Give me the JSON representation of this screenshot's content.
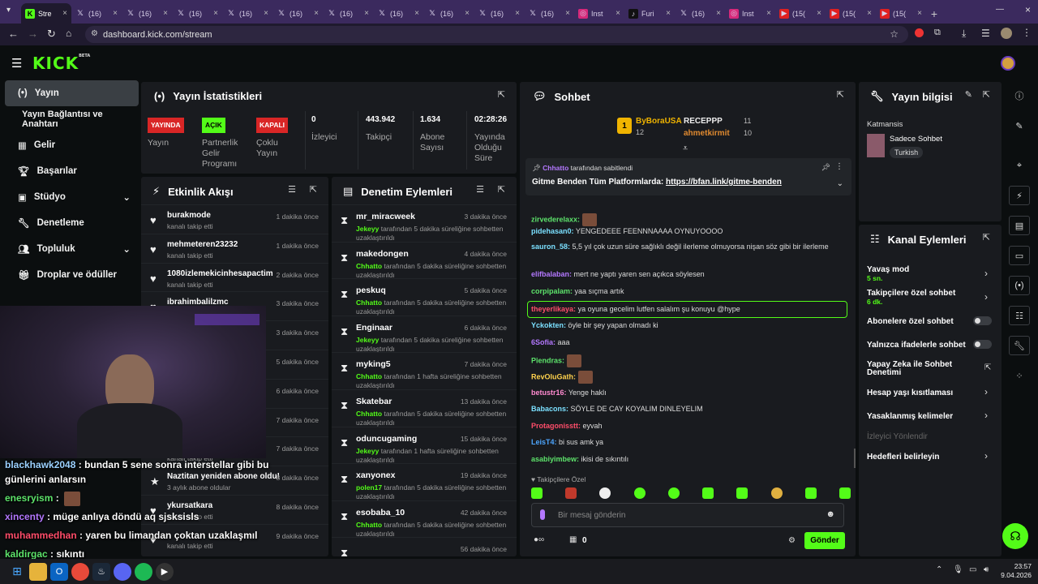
{
  "browser": {
    "tabs": [
      {
        "label": "Stre",
        "icon": "kick-icon",
        "active": true
      },
      {
        "label": "(16)",
        "icon": "x-icon"
      },
      {
        "label": "(16)",
        "icon": "x-icon"
      },
      {
        "label": "(16)",
        "icon": "x-icon"
      },
      {
        "label": "(16)",
        "icon": "x-icon"
      },
      {
        "label": "(16)",
        "icon": "x-icon"
      },
      {
        "label": "(16)",
        "icon": "x-icon"
      },
      {
        "label": "(16)",
        "icon": "x-icon"
      },
      {
        "label": "(16)",
        "icon": "x-icon"
      },
      {
        "label": "(16)",
        "icon": "x-icon"
      },
      {
        "label": "(16)",
        "icon": "x-icon"
      },
      {
        "label": "Inst",
        "icon": "instagram-icon"
      },
      {
        "label": "Furi",
        "icon": "tiktok-icon"
      },
      {
        "label": "(16)",
        "icon": "x-icon"
      },
      {
        "label": "Inst",
        "icon": "instagram-icon"
      },
      {
        "label": "(15(",
        "icon": "youtube-icon"
      },
      {
        "label": "(15(",
        "icon": "youtube-icon"
      },
      {
        "label": "(15(",
        "icon": "youtube-icon"
      }
    ],
    "url": "dashboard.kick.com/stream"
  },
  "kick": {
    "logo": "KICK",
    "beta": "BETA"
  },
  "sidebar": {
    "items": [
      {
        "label": "Yayın",
        "icon": "broadcast-icon"
      },
      {
        "label": "Yayın Bağlantısı ve Anahtarı",
        "icon": ""
      },
      {
        "label": "Gelir",
        "icon": "grid-icon"
      },
      {
        "label": "Başarılar",
        "icon": "trophy-icon"
      },
      {
        "label": "Stüdyo",
        "icon": "studio-icon"
      },
      {
        "label": "Denetleme",
        "icon": "wrench-icon"
      },
      {
        "label": "Topluluk",
        "icon": "community-icon"
      },
      {
        "label": "Droplar ve ödüller",
        "icon": "gift-icon"
      }
    ]
  },
  "stats": {
    "title": "Yayın İstatistikleri",
    "live_badge": "YAYINDA",
    "live_label": "Yayın",
    "partner_badge": "AÇIK",
    "partner_label": "Partnerlik Gelir Programı",
    "multi_badge": "KAPALI",
    "multi_label": "Çoklu Yayın",
    "viewers": "0",
    "viewers_label": "İzleyici",
    "followers": "443.942",
    "followers_label": "Takipçi",
    "subs": "1.634",
    "subs_label": "Abone Sayısı",
    "uptime": "02:28:26",
    "uptime_label": "Yayında Olduğu Süre"
  },
  "activity": {
    "title": "Etkinlik Akışı",
    "items": [
      {
        "name": "burakmode",
        "sub": "kanalı takip etti",
        "time": "1 dakika önce"
      },
      {
        "name": "mehmeteren23232",
        "sub": "kanalı takip etti",
        "time": "1 dakika önce"
      },
      {
        "name": "1080izlemekicinhesapactim",
        "sub": "kanalı takip etti",
        "time": "2 dakika önce"
      },
      {
        "name": "ibrahimbalilzmc",
        "sub": "",
        "time": "3 dakika önce"
      },
      {
        "name": "",
        "sub": "",
        "time": "3 dakika önce"
      },
      {
        "name": "",
        "sub": "",
        "time": "5 dakika önce"
      },
      {
        "name": "",
        "sub": "",
        "time": "6 dakika önce"
      },
      {
        "name": "",
        "sub": "",
        "time": "7 dakika önce"
      },
      {
        "name": "",
        "sub": "kanalı takip etti",
        "time": "7 dakika önce"
      },
      {
        "name": "Naztitan yeniden abone oldu!",
        "sub": "3 aylık abone oldular",
        "time": "8 dakika önce"
      },
      {
        "name": "ykursatkara",
        "sub": "kanalı takip etti",
        "time": "8 dakika önce"
      },
      {
        "name": "",
        "sub": "kanalı takip etti",
        "time": "9 dakika önce"
      }
    ]
  },
  "moderation": {
    "title": "Denetim Eylemleri",
    "items": [
      {
        "name": "mr_miracweek",
        "mod": "Jekeyy",
        "text": "tarafından 5 dakika süreliğine sohbetten uzaklaştırıldı",
        "time": "3 dakika önce"
      },
      {
        "name": "makedongen",
        "mod": "Chhatto",
        "text": "tarafından 5 dakika süreliğine sohbetten uzaklaştırıldı",
        "time": "4 dakika önce"
      },
      {
        "name": "peskuq",
        "mod": "Chhatto",
        "text": "tarafından 5 dakika süreliğine sohbetten uzaklaştırıldı",
        "time": "5 dakika önce"
      },
      {
        "name": "Enginaar",
        "mod": "Jekeyy",
        "text": "tarafından 5 dakika süreliğine sohbetten uzaklaştırıldı",
        "time": "6 dakika önce"
      },
      {
        "name": "myking5",
        "mod": "Chhatto",
        "text": "tarafından 1 hafta süreliğine sohbetten uzaklaştırıldı",
        "time": "7 dakika önce"
      },
      {
        "name": "Skatebar",
        "mod": "Chhatto",
        "text": "tarafından 5 dakika süreliğine sohbetten uzaklaştırıldı",
        "time": "13 dakika önce"
      },
      {
        "name": "oduncugaming",
        "mod": "Jekeyy",
        "text": "tarafından 1 hafta süreliğine sohbetten uzaklaştırıldı",
        "time": "15 dakika önce"
      },
      {
        "name": "xanyonex",
        "mod": "polen17",
        "text": "tarafından 5 dakika süreliğine sohbetten uzaklaştırıldı",
        "time": "19 dakika önce"
      },
      {
        "name": "esobaba_10",
        "mod": "Chhatto",
        "text": "tarafından 5 dakika süreliğine sohbetten uzaklaştırıldı",
        "time": "42 dakika önce"
      },
      {
        "name": "",
        "mod": "",
        "text": "",
        "time": "56 dakika önce"
      }
    ]
  },
  "chat": {
    "title": "Sohbet",
    "leaderboard": {
      "first_name": "ByBoraUSA",
      "first_count": "12",
      "second_name": "RECEPPP",
      "second_count": "11",
      "third_name": "ahmetkirmit",
      "third_count": "10"
    },
    "pinned": {
      "by": "Chhatto",
      "by_suffix": "tarafından sabitlendi",
      "text": "Gitme Benden Tüm Platformlarda:",
      "link": "https://bfan.link/gitme-benden"
    },
    "messages": [
      {
        "user": "zirvederelaxx:",
        "color": "#5de36b",
        "text": "",
        "emote": true
      },
      {
        "user": "pidehasan0:",
        "color": "#7be0ff",
        "text": "YENGEDEEE FEENNNAAAA OYNUYOOOO"
      },
      {
        "user": "sauron_58:",
        "color": "#7be0ff",
        "text": "5,5 yıl çok uzun süre sağlıklı değil ilerleme olmuyorsa nişan söz gibi bir ilerleme"
      },
      {
        "user": "elifbalaban:",
        "color": "#b478ff",
        "text": "mert ne yaptı yaren sen açıkca söylesen"
      },
      {
        "user": "corpipalam:",
        "color": "#5de36b",
        "text": "yaa sıçma artık"
      },
      {
        "user": "theyerlikaya:",
        "color": "#ff4d6a",
        "text": "ya oyuna gecelim lutfen salalım şu konuyu @hype",
        "highlight": true
      },
      {
        "user": "Yckokten:",
        "color": "#7be0ff",
        "text": "öyle bir şey yapan olmadı ki"
      },
      {
        "user": "6Sofia:",
        "color": "#b478ff",
        "text": "aaa"
      },
      {
        "user": "Piendras:",
        "color": "#5de36b",
        "text": "",
        "emote": true
      },
      {
        "user": "RevOluGath:",
        "color": "#ffd24d",
        "text": "",
        "emote": true
      },
      {
        "user": "betustr16:",
        "color": "#ff8ad0",
        "text": "Yenge haklı"
      },
      {
        "user": "Babacons:",
        "color": "#7be0ff",
        "text": "SÖYLE DE CAY KOYALIM DINLEYELIM"
      },
      {
        "user": "Protagonisstt:",
        "color": "#ff4d6a",
        "text": "eyvah"
      },
      {
        "user": "LeisT4:",
        "color": "#4da6ff",
        "text": "bi sus amk ya"
      },
      {
        "user": "asabiyimbew:",
        "color": "#5de36b",
        "text": "ikisi de sıkıntılı"
      }
    ],
    "followers_only": "Takipçilere Özel",
    "input_placeholder": "Bir mesaj gönderin",
    "points": "0",
    "send_label": "Gönder"
  },
  "stream_info": {
    "title": "Yayın bilgisi",
    "category": "Katmansis",
    "category_name": "Sadece Sohbet",
    "tag": "Turkish"
  },
  "channel_actions": {
    "title": "Kanal Eylemleri",
    "slow_mode": "Yavaş mod",
    "slow_mode_value": "5 sn.",
    "followers_only": "Takipçilere özel sohbet",
    "followers_only_value": "6 dk.",
    "subs_only": "Abonelere özel sohbet",
    "emote_only": "Yalnızca ifadelerle sohbet",
    "ai_mod": "Yapay Zeka ile Sohbet Denetimi",
    "account_age": "Hesap yaşı kısıtlaması",
    "banned_words": "Yasaklanmış kelimeler",
    "redirect": "İzleyici Yönlendir",
    "goals": "Hedefleri belirleyin"
  },
  "overlay_chat": [
    {
      "user": "blackhawk2048",
      "color": "#9bd1ff",
      "text": " : bundan 5 sene sonra interstellar gibi bu"
    },
    {
      "user": "",
      "color": "#ffffff",
      "text": "günlerini anlarsın"
    },
    {
      "user": "enesryism",
      "color": "#5de36b",
      "text": " :"
    },
    {
      "user": "xincenty",
      "color": "#b478ff",
      "text": " : müge anlıya döndü aq sjsksisls"
    },
    {
      "user": "muhammedhan",
      "color": "#ff4d6a",
      "text": " : yaren bu limandan çoktan uzaklaşmıl"
    },
    {
      "user": "kaldirgac",
      "color": "#5de36b",
      "text": " : sıkıntı"
    }
  ],
  "taskbar": {
    "time": "23:57",
    "date": "9.04.2026"
  },
  "colors": {
    "kick_green": "#53fc18",
    "panel": "#191b1f",
    "background": "#0b0e0f"
  }
}
